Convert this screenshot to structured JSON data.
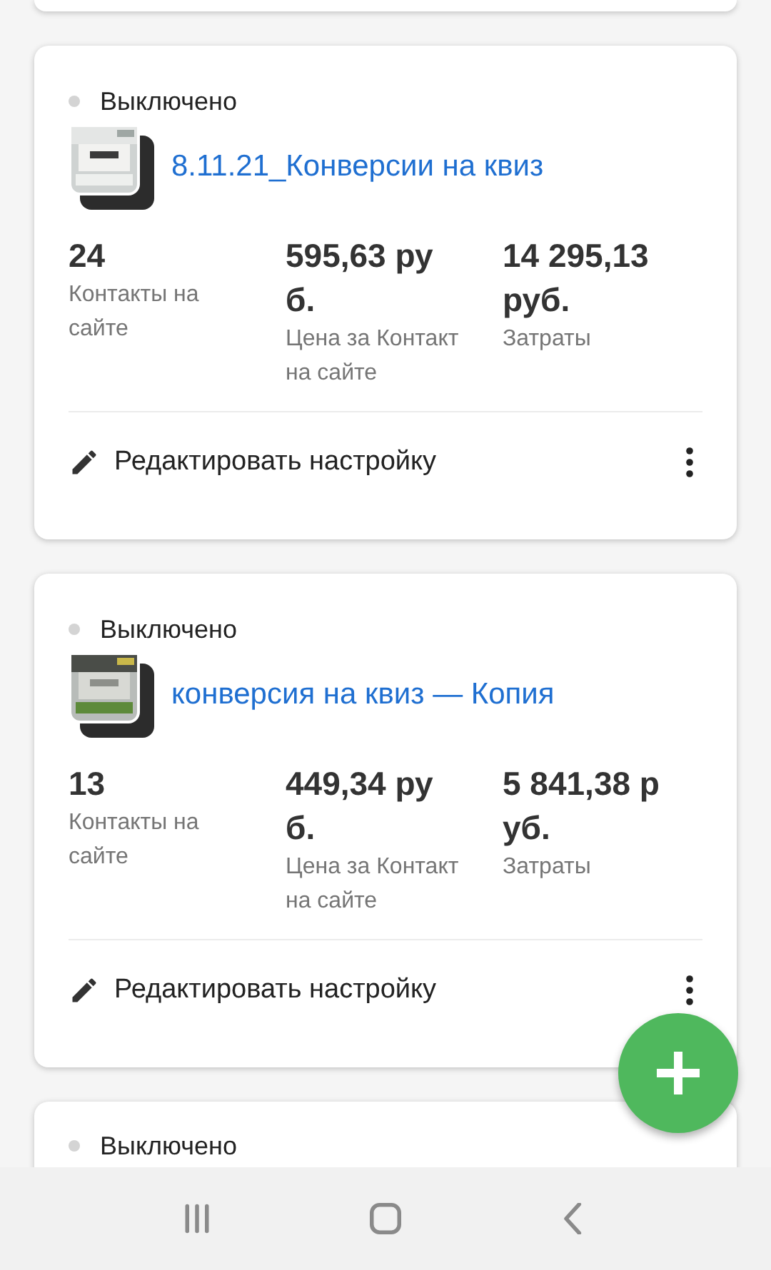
{
  "cards": [
    {
      "status": "Выключено",
      "active": false,
      "title": "8.11.21_Конверсии на квиз",
      "metrics": [
        {
          "value": "24",
          "label": "Контакты на сайте"
        },
        {
          "value": "595,63 руб.",
          "label": "Цена за Контакт на сайте"
        },
        {
          "value": "14 295,13 руб.",
          "label": "Затраты"
        }
      ],
      "action": "Редактировать настройку"
    },
    {
      "status": "Выключено",
      "active": false,
      "title": "конверсия на квиз — Копия",
      "metrics": [
        {
          "value": "13",
          "label": "Контакты на сайте"
        },
        {
          "value": "449,34 руб.",
          "label": "Цена за Контакт на сайте"
        },
        {
          "value": "5 841,38 руб.",
          "label": "Затраты"
        }
      ],
      "action": "Редактировать настройку"
    }
  ],
  "partial_card": {
    "status": "Выключено",
    "active": false
  }
}
